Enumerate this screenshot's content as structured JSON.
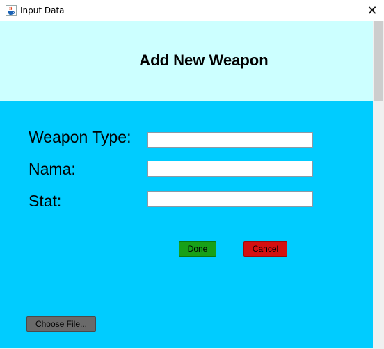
{
  "window": {
    "title": "Input Data",
    "close_symbol": "✕"
  },
  "header": {
    "title": "Add New Weapon",
    "background": "#ccffff"
  },
  "form": {
    "background": "#00ccff",
    "fields": [
      {
        "label": "Weapon Type:",
        "value": ""
      },
      {
        "label": "Nama:",
        "value": ""
      },
      {
        "label": "Stat:",
        "value": ""
      }
    ]
  },
  "buttons": {
    "done": "Done",
    "cancel": "Cancel",
    "choose_file": "Choose File..."
  },
  "colors": {
    "done": "#18a018",
    "cancel": "#d41010",
    "choose_file": "#6a6a6a"
  }
}
